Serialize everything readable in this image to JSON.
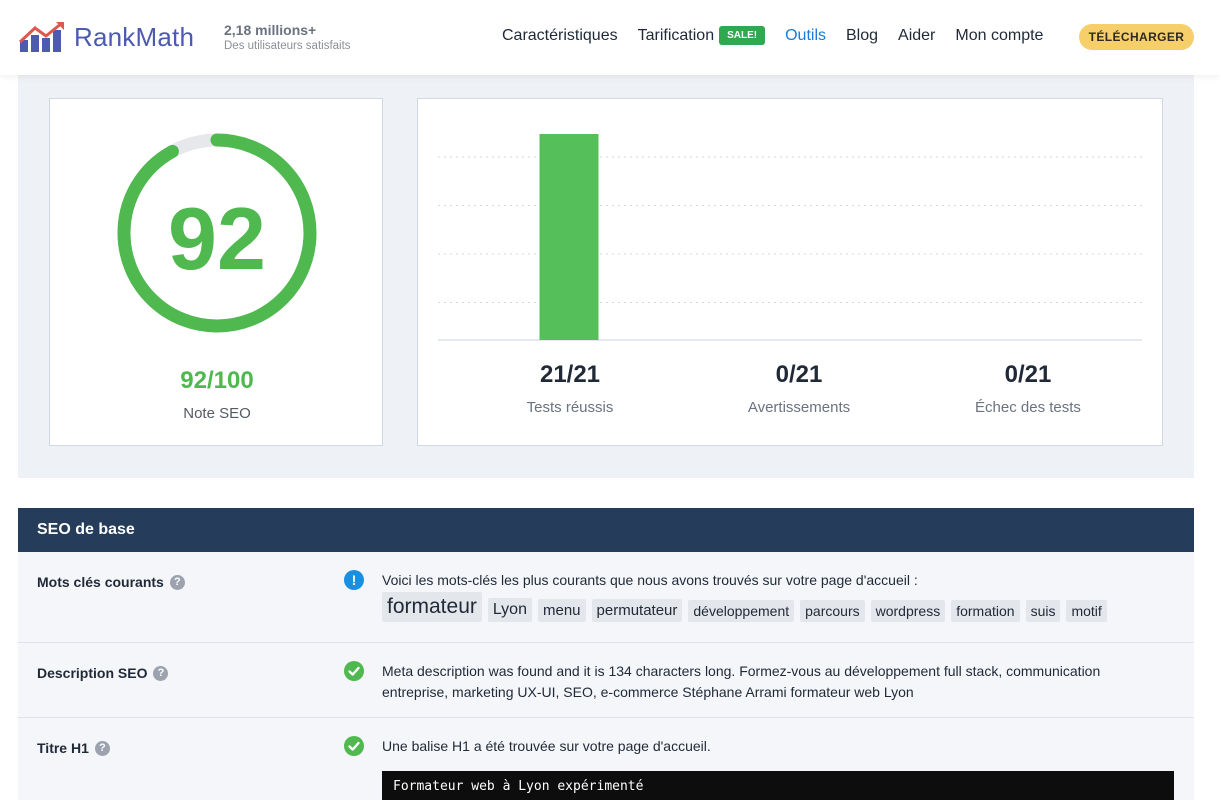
{
  "header": {
    "logo_text_a": "Rank",
    "logo_text_b": "Math",
    "users_count": "2,18 millions+",
    "users_sub": "Des utilisateurs satisfaits",
    "nav": [
      {
        "label": "Caractéristiques"
      },
      {
        "label": "Tarification",
        "badge": "SALE!"
      },
      {
        "label": "Outils",
        "active": true
      },
      {
        "label": "Blog"
      },
      {
        "label": "Aider"
      },
      {
        "label": "Mon compte"
      }
    ],
    "download_label": "TÉLÉCHARGER"
  },
  "score": {
    "value": 92,
    "value_text": "92",
    "fraction_text": "92/100",
    "label": "Note SEO",
    "color": "#4fb94f"
  },
  "chart_data": {
    "type": "bar",
    "categories": [
      "Tests réussis",
      "Avertissements",
      "Échec des tests"
    ],
    "values": [
      21,
      0,
      0
    ],
    "ylim": [
      0,
      21
    ],
    "grid": true,
    "bar_color": "#55bf59",
    "stats": [
      {
        "value": "21/21",
        "label": "Tests réussis"
      },
      {
        "value": "0/21",
        "label": "Avertissements"
      },
      {
        "value": "0/21",
        "label": "Échec des tests"
      }
    ]
  },
  "seo": {
    "section_title": "SEO de base",
    "rows": [
      {
        "label": "Mots clés courants",
        "status": "info",
        "text": "Voici les mots-clés les plus courants que nous avons trouvés sur votre page d'accueil :",
        "tags": [
          "formateur",
          "Lyon",
          "menu",
          "permutateur",
          "développement",
          "parcours",
          "wordpress",
          "formation",
          "suis",
          "motif"
        ]
      },
      {
        "label": "Description SEO",
        "status": "ok",
        "text": "Meta description was found and it is 134 characters long. Formez-vous au développement full stack, communication entreprise, marketing UX-UI, SEO, e-commerce Stéphane Arrami formateur web Lyon"
      },
      {
        "label": "Titre H1",
        "status": "ok",
        "text": "Une balise H1 a été trouvée sur votre page d'accueil.",
        "code": "Formateur web à Lyon expérimenté"
      }
    ]
  }
}
